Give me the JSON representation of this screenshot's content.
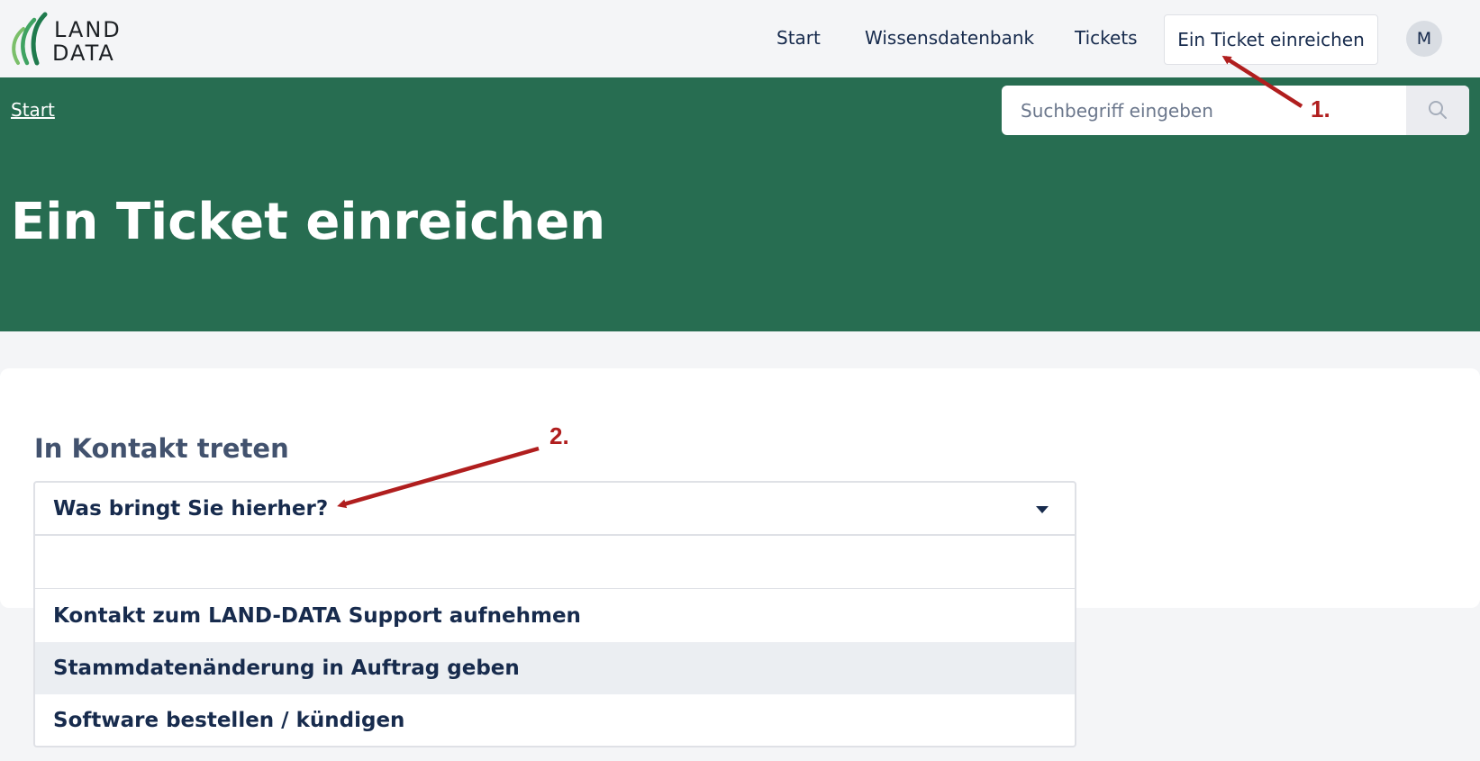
{
  "brand": {
    "logo_line1": "LAND",
    "logo_line2": "DATA",
    "colors": {
      "header_bg": "#f4f5f7",
      "banner_bg": "#276d51",
      "logo_green": "#2e8b57",
      "annotation_red": "#b01e1e"
    }
  },
  "nav": {
    "items": [
      {
        "label": "Start"
      },
      {
        "label": "Wissensdatenbank"
      },
      {
        "label": "Tickets"
      }
    ],
    "cta_label": "Ein Ticket einreichen",
    "avatar_initial": "M"
  },
  "banner": {
    "breadcrumb": "Start",
    "search_placeholder": "Suchbegriff eingeben",
    "search_icon": "search-icon",
    "page_title": "Ein Ticket einreichen"
  },
  "form": {
    "section_title": "In Kontakt treten",
    "dropdown": {
      "selected_label": "Was bringt Sie hierher?",
      "filter_value": "",
      "options": [
        {
          "label": "Kontakt zum LAND-DATA Support aufnehmen"
        },
        {
          "label": "Stammdatenänderung in Auftrag geben"
        },
        {
          "label": "Software bestellen / kündigen"
        }
      ]
    }
  },
  "annotations": {
    "step1": "1.",
    "step2": "2."
  }
}
